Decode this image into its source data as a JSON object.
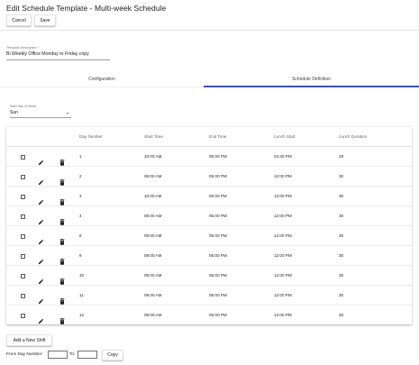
{
  "page": {
    "title": "Edit Schedule Template - Multi-week Schedule"
  },
  "toolbar": {
    "cancel_label": "Cancel",
    "save_label": "Save"
  },
  "form": {
    "description": {
      "label": "Template Description *",
      "value": "Bi Weekly Office Monday to Friday copy"
    }
  },
  "tabs": [
    {
      "label": "Configuration",
      "active": false
    },
    {
      "label": "Schedule Definition",
      "active": true
    }
  ],
  "start_day": {
    "label": "Start Day of Week",
    "selected": "Sun"
  },
  "table": {
    "headers": {
      "day_number": "Day Number",
      "start_time": "Start Time",
      "end_time": "End Time",
      "lunch_start": "Lunch Start",
      "lunch_duration": "Lunch Duration"
    },
    "rows": [
      {
        "day": "1",
        "start": "10:00 AM",
        "end": "05:00 PM",
        "lunch_start": "04:30 PM",
        "lunch_duration": "29"
      },
      {
        "day": "2",
        "start": "06:00 AM",
        "end": "05:00 PM",
        "lunch_start": "12:00 PM",
        "lunch_duration": "30"
      },
      {
        "day": "3",
        "start": "10:00 AM",
        "end": "05:00 PM",
        "lunch_start": "12:00 PM",
        "lunch_duration": "30"
      },
      {
        "day": "4",
        "start": "09:00 AM",
        "end": "05:00 PM",
        "lunch_start": "12:00 PM",
        "lunch_duration": "30"
      },
      {
        "day": "8",
        "start": "09:00 AM",
        "end": "05:00 PM",
        "lunch_start": "12:00 PM",
        "lunch_duration": "30"
      },
      {
        "day": "9",
        "start": "09:00 AM",
        "end": "05:00 PM",
        "lunch_start": "12:00 PM",
        "lunch_duration": "30"
      },
      {
        "day": "10",
        "start": "09:00 AM",
        "end": "05:00 PM",
        "lunch_start": "12:00 PM",
        "lunch_duration": "30"
      },
      {
        "day": "11",
        "start": "09:00 AM",
        "end": "05:00 PM",
        "lunch_start": "12:00 PM",
        "lunch_duration": "30"
      },
      {
        "day": "12",
        "start": "09:00 AM",
        "end": "05:00 PM",
        "lunch_start": "12:00 PM",
        "lunch_duration": "30"
      }
    ]
  },
  "actions": {
    "add_shift_label": "Add a New Shift"
  },
  "copy": {
    "from_label": "From Day Number:",
    "to_label": "To:",
    "from_value": "",
    "to_value": "",
    "button_label": "Copy"
  },
  "colors": {
    "accent": "#3f51b5",
    "icon": "#212121",
    "divider": "#e0e0e0"
  }
}
